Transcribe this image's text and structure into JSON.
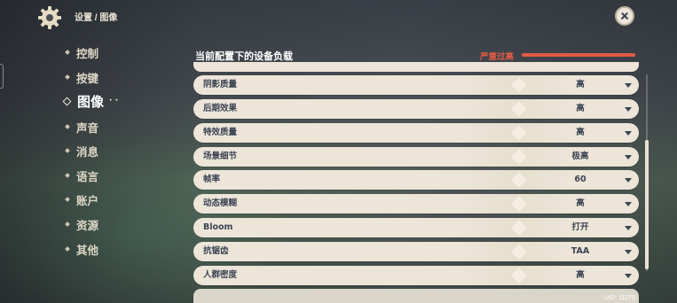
{
  "header": {
    "breadcrumb": "设置 / 图像",
    "settings_icon": "gear-icon",
    "close_icon": "close-icon"
  },
  "nav": {
    "items": [
      {
        "label": "控制",
        "active": false
      },
      {
        "label": "按键",
        "active": false
      },
      {
        "label": "图像",
        "active": true
      },
      {
        "label": "声音",
        "active": false
      },
      {
        "label": "消息",
        "active": false
      },
      {
        "label": "语言",
        "active": false
      },
      {
        "label": "账户",
        "active": false
      },
      {
        "label": "资源",
        "active": false
      },
      {
        "label": "其他",
        "active": false
      }
    ]
  },
  "load": {
    "title": "当前配置下的设备负载",
    "status": "严重过高",
    "level": 1.0,
    "color": "#e25a45"
  },
  "settings": [
    {
      "label": "阴影质量",
      "value": "高"
    },
    {
      "label": "后期效果",
      "value": "高"
    },
    {
      "label": "特效质量",
      "value": "高"
    },
    {
      "label": "场景细节",
      "value": "极高"
    },
    {
      "label": "帧率",
      "value": "60"
    },
    {
      "label": "动态模糊",
      "value": "高"
    },
    {
      "label": "Bloom",
      "value": "打开"
    },
    {
      "label": "抗锯齿",
      "value": "TAA"
    },
    {
      "label": "人群密度",
      "value": "高"
    }
  ],
  "footer": {
    "uid": "UID: 11279"
  }
}
